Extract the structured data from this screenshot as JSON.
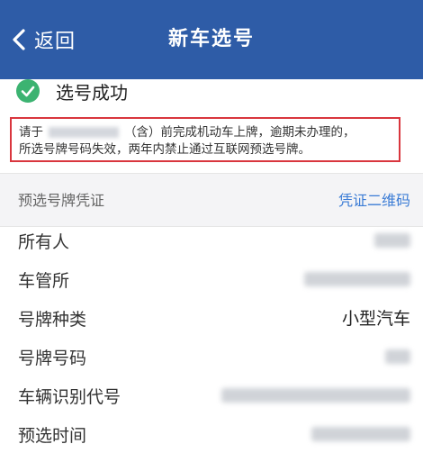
{
  "header": {
    "back_label": "返回",
    "title": "新车选号"
  },
  "status": {
    "text": "选号成功",
    "color": "#3cb371"
  },
  "notice": {
    "prefix": "请于",
    "suffix": "（含）前完成机动车上牌，逾期未办理的，",
    "line2": "所选号牌号码失效，两年内禁止通过互联网预选号牌。"
  },
  "section": {
    "title": "预选号牌凭证",
    "qr_link": "凭证二维码"
  },
  "rows": [
    {
      "label": "所有人",
      "value": ""
    },
    {
      "label": "车管所",
      "value": ""
    },
    {
      "label": "号牌种类",
      "value": "小型汽车"
    },
    {
      "label": "号牌号码",
      "value": ""
    },
    {
      "label": "车辆识别代号",
      "value": ""
    },
    {
      "label": "预选时间",
      "value": ""
    }
  ],
  "colors": {
    "header_bg": "#2e5ca7",
    "notice_border": "#d9363e",
    "link": "#3a7bd5"
  }
}
